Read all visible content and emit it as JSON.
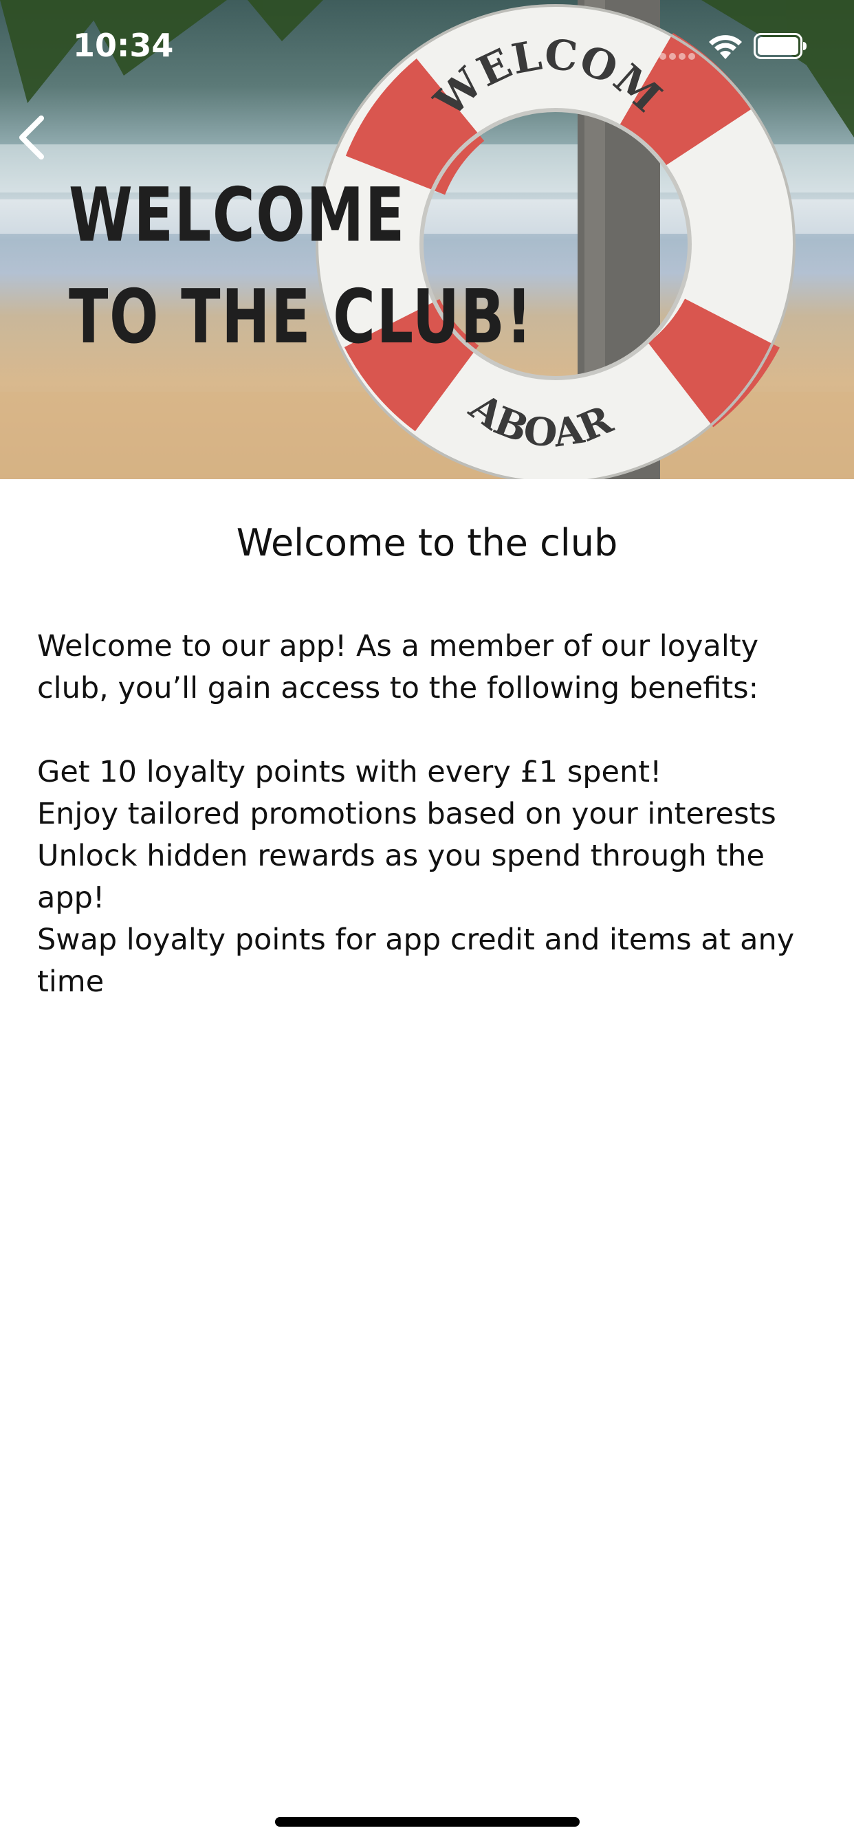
{
  "status_bar": {
    "time": "10:34"
  },
  "hero": {
    "headline_line1": "WELCOME",
    "headline_line2": "TO THE CLUB!",
    "ring_text_top": "WELCOME",
    "ring_text_bottom": "ABOARD"
  },
  "page": {
    "title": "Welcome to the club",
    "intro": "Welcome to our app! As a member of our loyalty club, you’ll gain access to the following benefits:",
    "benefits": [
      "Get 10 loyalty points with every £1 spent!",
      "Enjoy tailored promotions based on your interests",
      "Unlock hidden rewards as you spend through the app!",
      "Swap loyalty points for app credit and items at any time"
    ]
  },
  "icons": {
    "back": "chevron-left-icon",
    "signal": "signal-icon",
    "wifi": "wifi-icon",
    "battery": "battery-icon"
  },
  "colors": {
    "ring_red": "#d9564f",
    "ring_white": "#f2f2ef",
    "headline": "#1f1f1f",
    "text": "#111111"
  }
}
